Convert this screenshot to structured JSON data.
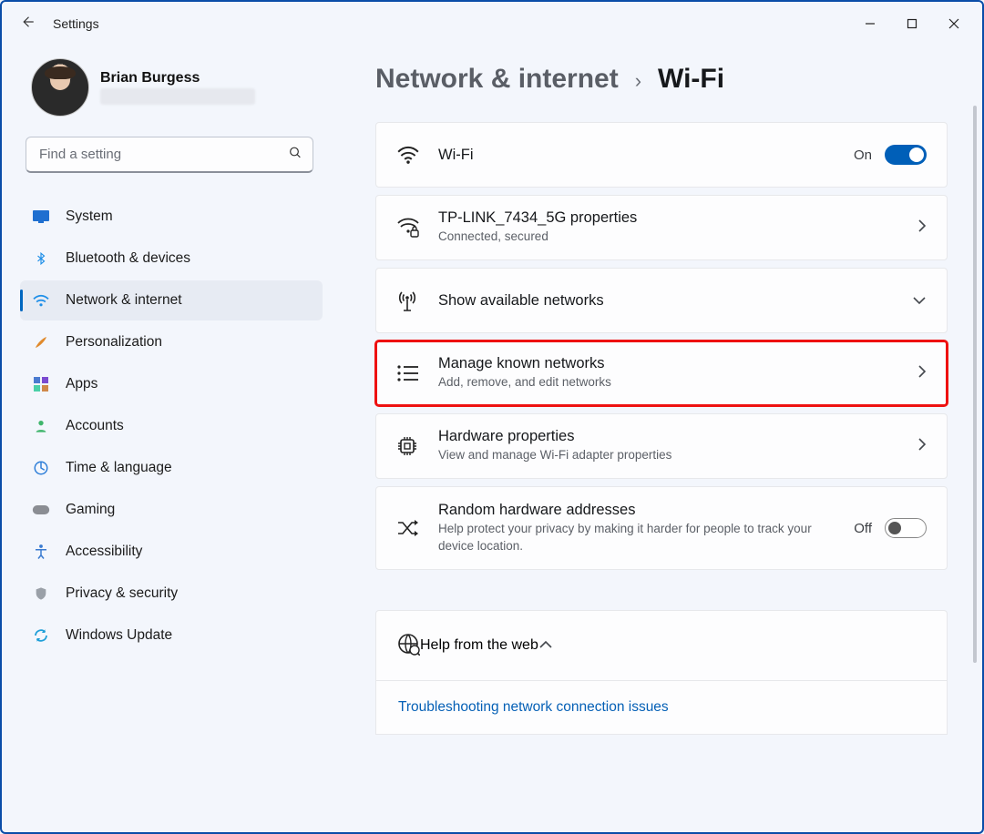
{
  "window": {
    "app_title": "Settings",
    "ctrl_minimize": "Minimize",
    "ctrl_maximize": "Maximize",
    "ctrl_close": "Close"
  },
  "account": {
    "user_name": "Brian Burgess"
  },
  "search": {
    "placeholder": "Find a setting"
  },
  "sidebar": {
    "items": {
      "0": {
        "label": "System",
        "icon": "monitor-icon"
      },
      "1": {
        "label": "Bluetooth & devices",
        "icon": "bluetooth-icon"
      },
      "2": {
        "label": "Network & internet",
        "icon": "wifi-icon"
      },
      "3": {
        "label": "Personalization",
        "icon": "brush-icon"
      },
      "4": {
        "label": "Apps",
        "icon": "grid-icon"
      },
      "5": {
        "label": "Accounts",
        "icon": "person-icon"
      },
      "6": {
        "label": "Time & language",
        "icon": "clock-globe-icon"
      },
      "7": {
        "label": "Gaming",
        "icon": "gamepad-icon"
      },
      "8": {
        "label": "Accessibility",
        "icon": "accessibility-icon"
      },
      "9": {
        "label": "Privacy & security",
        "icon": "shield-icon"
      },
      "10": {
        "label": "Windows Update",
        "icon": "update-icon"
      }
    },
    "selected_index": 2
  },
  "breadcrumb": {
    "parent": "Network & internet",
    "current": "Wi-Fi"
  },
  "cards": {
    "wifi": {
      "title": "Wi-Fi",
      "state_label": "On",
      "state": "on"
    },
    "net_props": {
      "title": "TP-LINK_7434_5G properties",
      "subtitle": "Connected, secured"
    },
    "avail": {
      "title": "Show available networks"
    },
    "manage": {
      "title": "Manage known networks",
      "subtitle": "Add, remove, and edit networks"
    },
    "hw": {
      "title": "Hardware properties",
      "subtitle": "View and manage Wi-Fi adapter properties"
    },
    "rand": {
      "title": "Random hardware addresses",
      "subtitle": "Help protect your privacy by making it harder for people to track your device location.",
      "state_label": "Off",
      "state": "off"
    }
  },
  "help": {
    "title": "Help from the web",
    "link1": "Troubleshooting network connection issues"
  }
}
